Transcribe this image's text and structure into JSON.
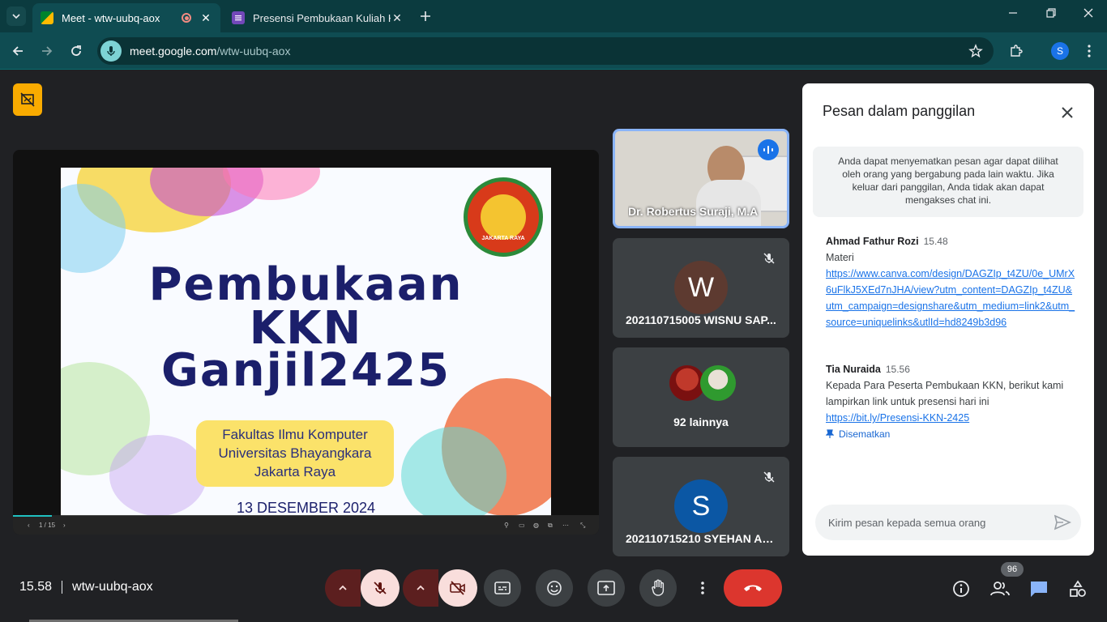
{
  "browser": {
    "tabs": [
      {
        "title": "Meet - wtw-uubq-aox",
        "active": true,
        "recording": true
      },
      {
        "title": "Presensi Pembukaan Kuliah Kerj",
        "active": false
      }
    ],
    "url_host": "meet.google.com",
    "url_path": "/wtw-uubq-aox",
    "profile_initial": "S"
  },
  "slide": {
    "title_line1": "Pembukaan",
    "title_line2": "KKN",
    "title_line3": "Ganjil2425",
    "faculty_line1": "Fakultas Ilmu Komputer",
    "faculty_line2": "Universitas Bhayangkara",
    "faculty_line3": "Jakarta Raya",
    "date": "13 DESEMBER 2024",
    "logo_text": "JAKARTA RAYA",
    "page_indicator": "1 / 15"
  },
  "tiles": [
    {
      "name": "Dr. Robertus Suraji, M.A",
      "speaking": true
    },
    {
      "name": "202110715005 WISNU SAP...",
      "initial": "W",
      "avatar_color": "#5d3a30",
      "muted": true
    },
    {
      "caption": "92 lainnya"
    },
    {
      "name": "202110715210 SYEHAN AU...",
      "initial": "S",
      "avatar_color": "#0b57a4",
      "muted": true
    }
  ],
  "chat": {
    "title": "Pesan dalam panggilan",
    "notice": "Anda dapat menyematkan pesan agar dapat dilihat oleh orang yang bergabung pada lain waktu. Jika keluar dari panggilan, Anda tidak akan dapat mengakses chat ini.",
    "messages": [
      {
        "sender": "Ahmad Fathur Rozi",
        "time": "15.48",
        "text": "Materi",
        "link": "https://www.canva.com/design/DAGZIp_t4ZU/0e_UMrX6uFlkJ5XEd7nJHA/view?utm_content=DAGZIp_t4ZU&utm_campaign=designshare&utm_medium=link2&utm_source=uniquelinks&utlId=hd8249b3d96"
      },
      {
        "sender": "Tia Nuraida",
        "time": "15.56",
        "text": "Kepada Para Peserta Pembukaan KKN, berikut kami lampirkan link untuk presensi hari ini",
        "link": "https://bit.ly/Presensi-KKN-2425",
        "pinned_label": "Disematkan"
      }
    ],
    "input_placeholder": "Kirim pesan kepada semua orang"
  },
  "bottom_bar": {
    "time": "15.58",
    "meeting_code": "wtw-uubq-aox",
    "participant_count": "96"
  },
  "colors": {
    "accent": "#1a73e8",
    "hangup": "#dc362e",
    "chrome_tab": "#0f4c52",
    "stage_badge": "#f9ab00"
  },
  "icons": [
    "tab-search-icon",
    "meet-favicon",
    "forms-favicon",
    "close-icon",
    "plus-icon",
    "minimize-icon",
    "restore-icon",
    "back-icon",
    "forward-icon",
    "reload-icon",
    "mic-icon",
    "star-icon",
    "extensions-icon",
    "more-vert-icon",
    "presentation-off-icon",
    "mic-off-icon",
    "camera-off-icon",
    "captions-icon",
    "emoji-icon",
    "present-icon",
    "raise-hand-icon",
    "hangup-icon",
    "info-icon",
    "people-icon",
    "chat-icon",
    "activities-icon",
    "send-icon",
    "pin-icon"
  ]
}
